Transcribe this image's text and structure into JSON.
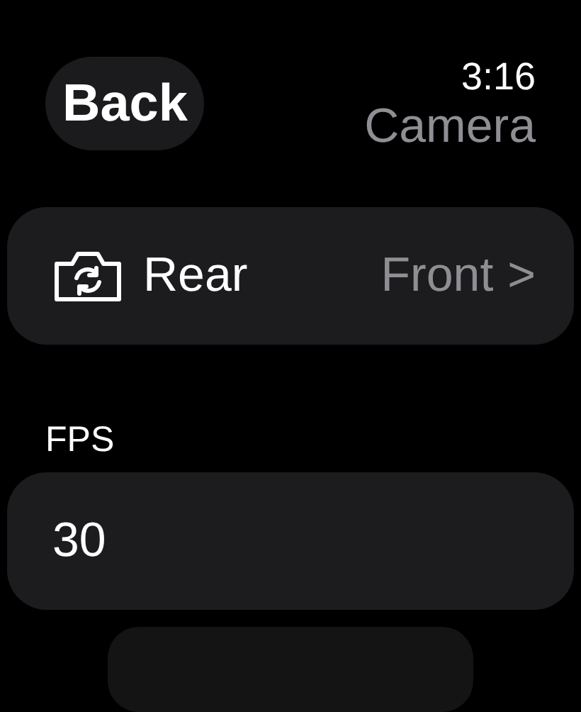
{
  "status_bar": {
    "time": "3:16"
  },
  "nav": {
    "back_label": "Back",
    "title": "Camera"
  },
  "camera_row": {
    "label": "Rear",
    "value": "Front",
    "chevron": ">"
  },
  "fps": {
    "label": "FPS",
    "value": "30"
  },
  "more_rows": [
    {
      "kind": "partial"
    }
  ]
}
